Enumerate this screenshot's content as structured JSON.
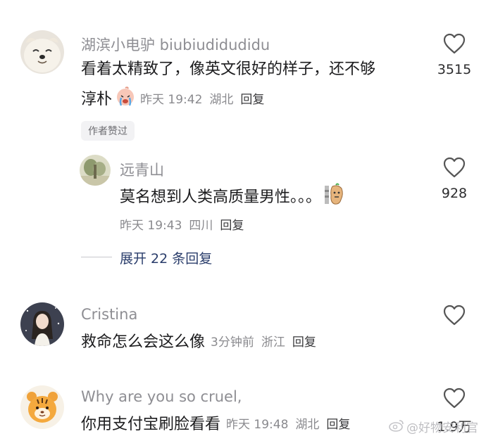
{
  "comments": [
    {
      "user": "湖滨小电驴 biubiudidudidu",
      "text_line1": "看着太精致了，像英文很好的样子，还不够",
      "text_line2": "淳朴",
      "time": "昨天 19:42",
      "location": "湖北",
      "reply": "回复",
      "badge": "作者赞过",
      "likes": "3515"
    },
    {
      "user": "远青山",
      "text": "莫名想到人类高质量男性。。。",
      "time": "昨天 19:43",
      "location": "四川",
      "reply": "回复",
      "likes": "928"
    },
    {
      "user": "Cristina",
      "text": "救命怎么会这么像",
      "time": "3分钟前",
      "location": "浙江",
      "reply": "回复",
      "likes": ""
    },
    {
      "user": "Why are you so cruel,",
      "text": "你用支付宝刷脸看看",
      "time": "昨天 19:48",
      "location": "湖北",
      "reply": "回复",
      "likes": "1.9万"
    }
  ],
  "expand_replies": "展开 22 条回复",
  "watermark": "@好物安利官",
  "icons": {
    "like": "heart-outline-icon",
    "weibo": "weibo-logo-icon",
    "emoji_crying": "crying-emoji-icon",
    "emoji_peanut": "peanut-emoji-icon"
  },
  "colors": {
    "expand_text": "#2a3d6b",
    "meta_text": "#8a8a8e",
    "username": "#8e8e93"
  }
}
